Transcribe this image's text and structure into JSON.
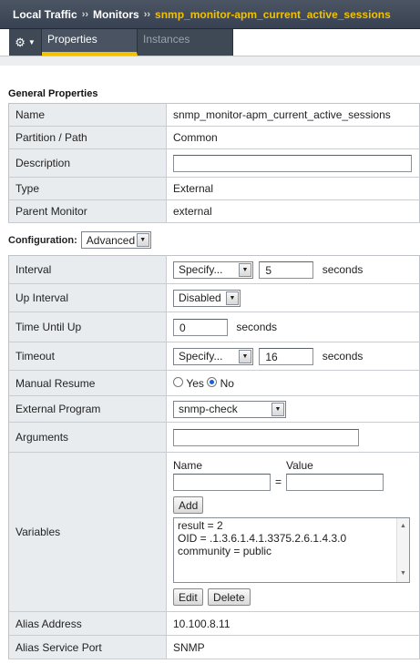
{
  "breadcrumb": {
    "items": [
      "Local Traffic",
      "Monitors"
    ],
    "current": "snmp_monitor-apm_current_active_sessions",
    "separator": "››"
  },
  "tabs": {
    "gear_icon": "gear-icon",
    "items": [
      {
        "label": "Properties",
        "active": true
      },
      {
        "label": "Instances",
        "active": false
      }
    ]
  },
  "general": {
    "title": "General Properties",
    "name_label": "Name",
    "name_value": "snmp_monitor-apm_current_active_sessions",
    "partition_label": "Partition / Path",
    "partition_value": "Common",
    "description_label": "Description",
    "description_value": "",
    "type_label": "Type",
    "type_value": "External",
    "parent_label": "Parent Monitor",
    "parent_value": "external"
  },
  "configuration": {
    "title": "Configuration:",
    "mode": "Advanced",
    "interval_label": "Interval",
    "interval_mode": "Specify...",
    "interval_value": "5",
    "seconds": "seconds",
    "up_interval_label": "Up Interval",
    "up_interval_value": "Disabled",
    "time_until_up_label": "Time Until Up",
    "time_until_up_value": "0",
    "timeout_label": "Timeout",
    "timeout_mode": "Specify...",
    "timeout_value": "16",
    "manual_resume_label": "Manual Resume",
    "manual_resume_yes": "Yes",
    "manual_resume_no": "No",
    "manual_resume_selected": "No",
    "external_program_label": "External Program",
    "external_program_value": "snmp-check",
    "arguments_label": "Arguments",
    "arguments_value": "",
    "variables_label": "Variables",
    "var_name_header": "Name",
    "var_value_header": "Value",
    "var_equals": "=",
    "add_button": "Add",
    "variables": [
      "result = 2",
      "OID = .1.3.6.1.4.1.3375.2.6.1.4.3.0",
      "community = public"
    ],
    "edit_button": "Edit",
    "delete_button": "Delete",
    "alias_address_label": "Alias Address",
    "alias_address_value": "10.100.8.11",
    "alias_port_label": "Alias Service Port",
    "alias_port_value": "SNMP"
  },
  "colors": {
    "header_bg": "#3f4855",
    "accent": "#f2c200",
    "label_bg": "#e9ecef"
  }
}
